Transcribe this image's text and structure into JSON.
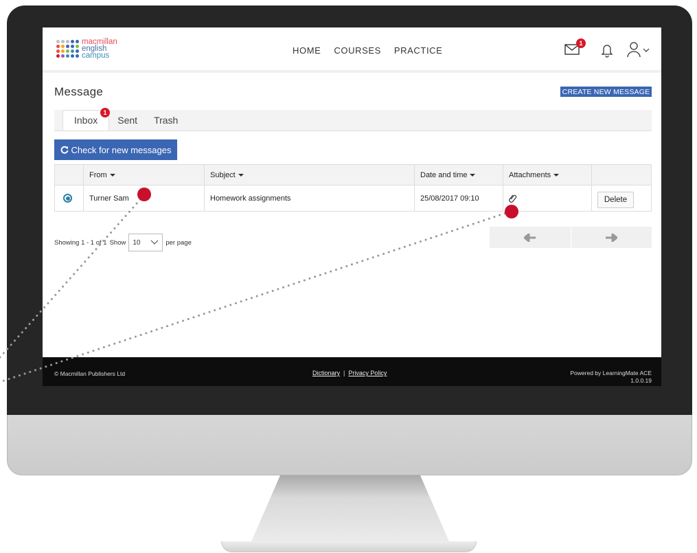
{
  "logo": {
    "line1": "macmillan",
    "line2": "english",
    "line3": "campus",
    "dot_colors": [
      "#bfbfbf",
      "#bfbfbf",
      "#bfbfbf",
      "#3a66b3",
      "#3a66b3",
      "#e84c3d",
      "#f5a623",
      "#3a66b3",
      "#3a66b3",
      "#7fbf3f",
      "#e84c3d",
      "#f5a623",
      "#7fbf3f",
      "#3a8fb7",
      "#3a66b3",
      "#d9182b",
      "#9b59b6",
      "#3a8fb7",
      "#3a66b3",
      "#3a66b3"
    ]
  },
  "nav": {
    "home": "HOME",
    "courses": "COURSES",
    "practice": "PRACTICE"
  },
  "header_icons": {
    "mail_badge": "1",
    "mail_icon": "envelope-icon",
    "bell_icon": "bell-icon",
    "user_icon": "user-icon"
  },
  "page": {
    "title": "Message",
    "create_button": "CREATE NEW MESSAGE"
  },
  "tabs": [
    {
      "label": "Inbox",
      "badge": "1"
    },
    {
      "label": "Sent"
    },
    {
      "label": "Trash"
    }
  ],
  "check_button": "Check for new messages",
  "table": {
    "headers": {
      "from": "From",
      "subject": "Subject",
      "date": "Date and time",
      "attachments": "Attachments"
    },
    "rows": [
      {
        "from": "Turner Sam",
        "subject": "Homework assignments",
        "date": "25/08/2017 09:10",
        "attachment_icon": "paperclip-icon",
        "action": "Delete"
      }
    ]
  },
  "paging": {
    "showing": "Showing 1 - 1 of 1",
    "show": "Show",
    "per_page_value": "10",
    "per_page": "per page"
  },
  "footer": {
    "copyright": "© Macmillan Publishers Ltd",
    "dictionary": "Dictionary",
    "separator": "|",
    "privacy": "Privacy Policy",
    "powered": "Powered by LearningMate ACE",
    "version": "1.0.0.19"
  },
  "colors": {
    "accent": "#3a66b3",
    "badge": "#d9182b",
    "annotation_dot": "#c8102e",
    "annotation_line": "#999999"
  }
}
